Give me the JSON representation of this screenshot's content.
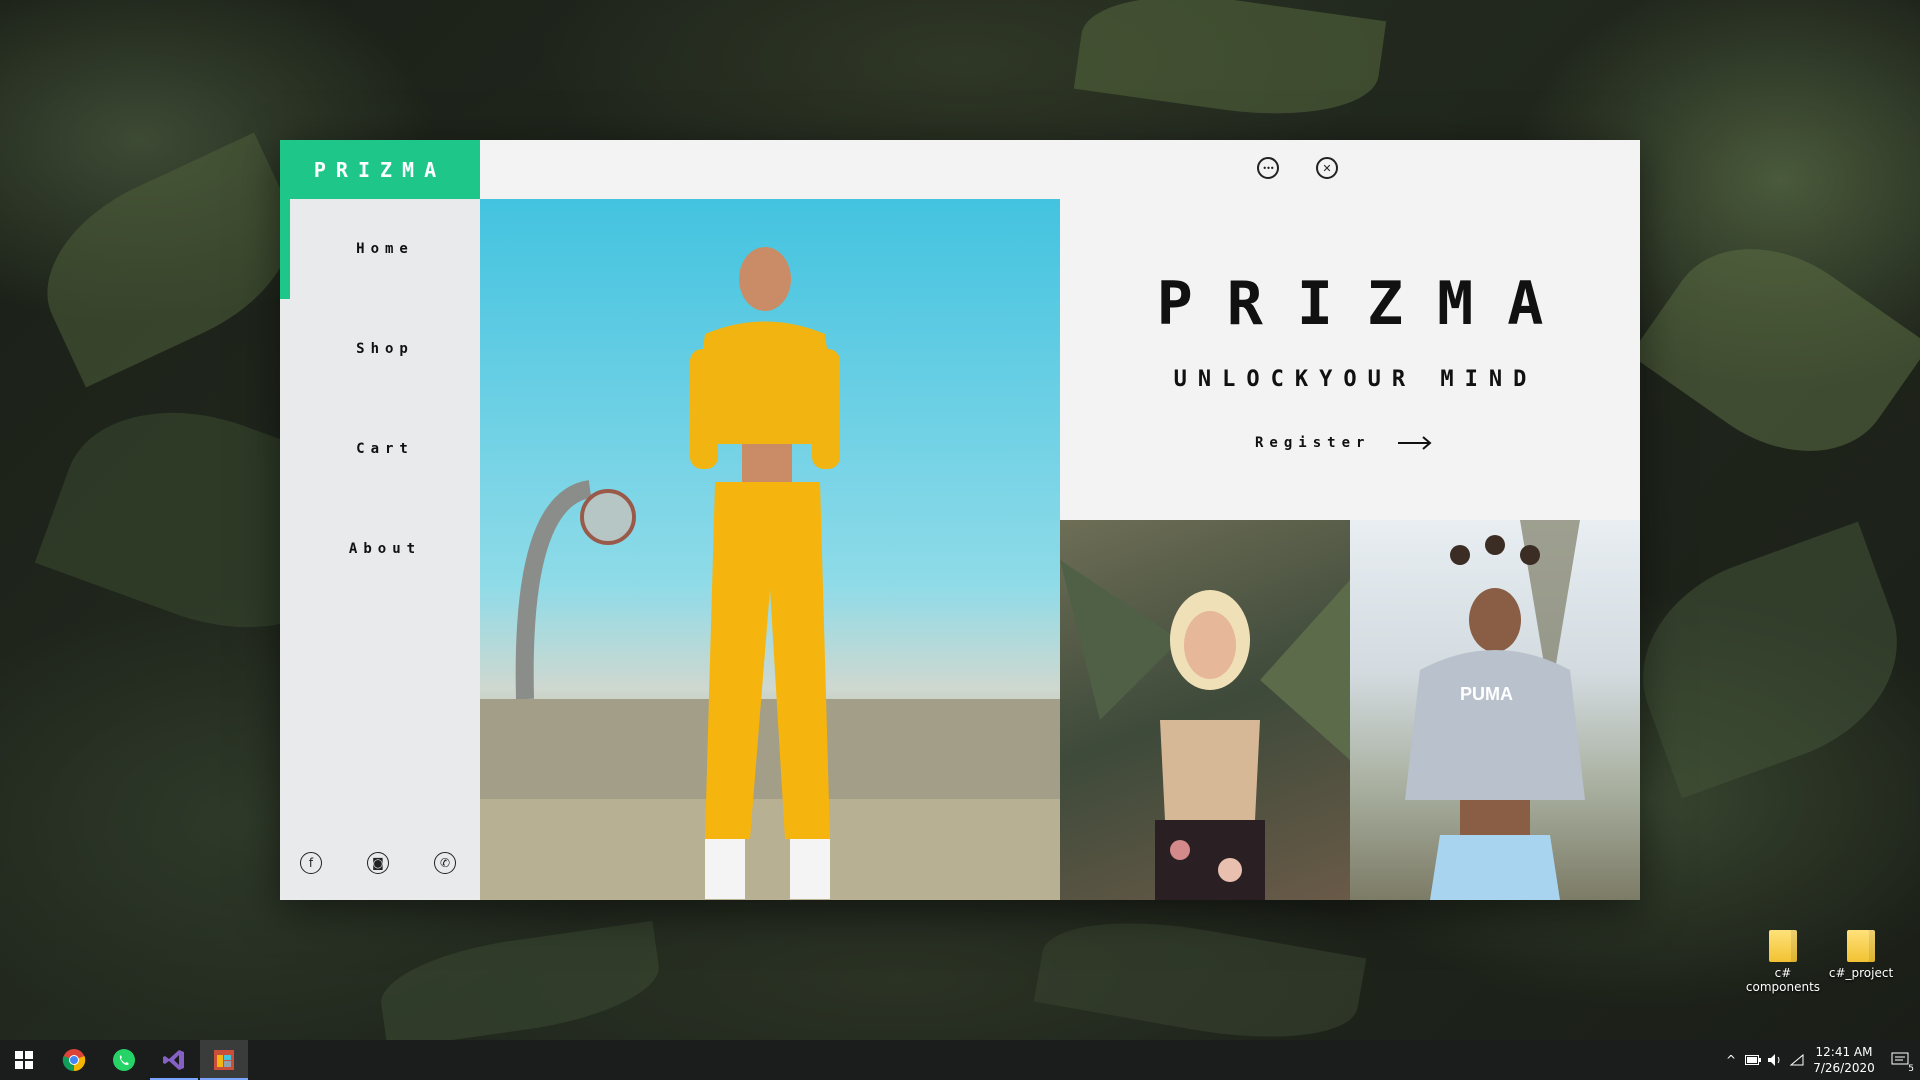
{
  "app": {
    "brand": "PRIZMA",
    "nav": [
      {
        "label": "Home",
        "active": true
      },
      {
        "label": "Shop"
      },
      {
        "label": "Cart"
      },
      {
        "label": "About"
      }
    ],
    "hero": {
      "title": "PRIZMA",
      "subtitle": "UNLOCKYOUR MIND",
      "register_label": "Register"
    },
    "social": [
      {
        "icon": "facebook-icon",
        "glyph": "f"
      },
      {
        "icon": "instagram-icon",
        "glyph": "◙"
      },
      {
        "icon": "whatsapp-icon",
        "glyph": "✆"
      }
    ],
    "window_buttons": {
      "more_glyph": "•••",
      "close_glyph": "✕"
    },
    "colors": {
      "accent": "#1ec68a",
      "sidebar_bg": "#e8eaeb",
      "content_bg": "#f3f3f3",
      "text": "#111111"
    }
  },
  "desktop": {
    "icons": [
      {
        "label": "c#\ncomponents",
        "line1": "c#",
        "line2": "components"
      },
      {
        "label": "c#_project",
        "line1": "c#_project",
        "line2": ""
      }
    ]
  },
  "taskbar": {
    "apps": [
      {
        "name": "start-button",
        "icon": "windows-logo-icon"
      },
      {
        "name": "chrome",
        "icon": "chrome-icon"
      },
      {
        "name": "whatsapp",
        "icon": "whatsapp-icon"
      },
      {
        "name": "visual-studio",
        "icon": "visual-studio-icon"
      },
      {
        "name": "prizma-app",
        "icon": "app-window-icon",
        "active": true
      }
    ],
    "tray": {
      "time": "12:41 AM",
      "date": "7/26/2020",
      "notifications": "5"
    }
  }
}
